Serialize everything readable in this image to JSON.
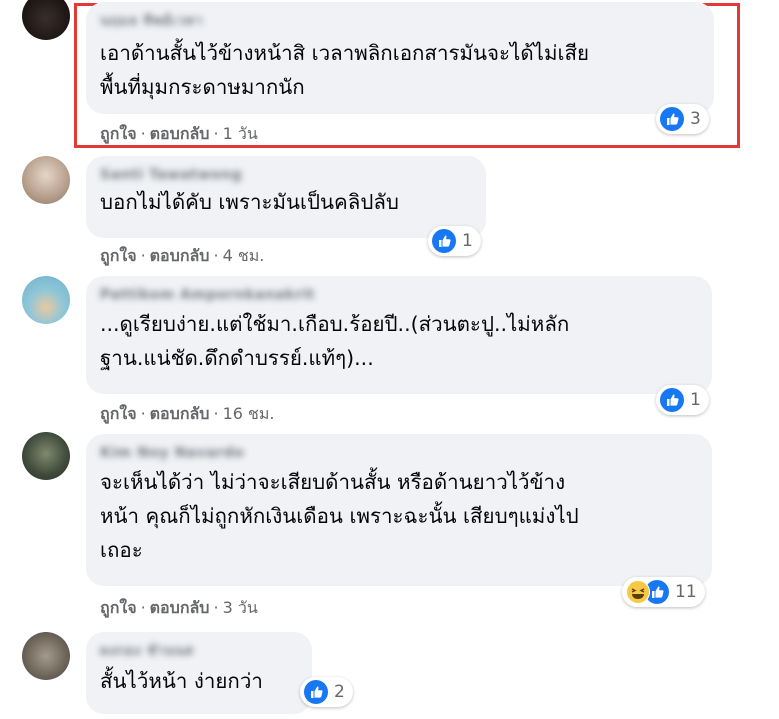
{
  "comments": [
    {
      "author": "นฤมล ทิพย์เวหา",
      "text": "เอาด้านสั้นไว้ข้างหน้าสิ เวลาพลิกเอกสารมันจะได้ไม่เสีย\nพื้นที่มุมกระดาษมากนัก",
      "like_label": "ถูกใจ",
      "reply_label": "ตอบกลับ",
      "time": "1 วัน",
      "reaction_count": "3"
    },
    {
      "author": "Santi Tawatwong",
      "text": "บอกไม่ได้คับ เพราะมันเป็นคลิปลับ",
      "like_label": "ถูกใจ",
      "reply_label": "ตอบกลับ",
      "time": "4 ชม.",
      "reaction_count": "1"
    },
    {
      "author": "Pattikom Ampornkanakrit",
      "text": "...ดูเรียบง่าย.แต่ใช้มา.เกือบ.ร้อยปี..(ส่วนตะปู..ไม่หลัก\nฐาน.แน่ชัด.ดึกดำบรรย์.แท้ๆ)...",
      "like_label": "ถูกใจ",
      "reply_label": "ตอบกลับ",
      "time": "16 ชม.",
      "reaction_count": "1"
    },
    {
      "author": "Kim Noy Navardo",
      "text": "จะเห็นได้ว่า ไม่ว่าจะเสียบด้านสั้น หรือด้านยาวไว้ข้าง\nหน้า คุณก็ไม่ถูกหักเงินเดือน เพราะฉะนั้น เสียบๆแม่งไป\nเถอะ",
      "like_label": "ถูกใจ",
      "reply_label": "ตอบกลับ",
      "time": "3 วัน",
      "reaction_count": "11"
    },
    {
      "author": "ผงกอง ชำนนส",
      "text": "สั้นไว้หน้า ง่ายกว่า",
      "reaction_count": "2"
    }
  ],
  "separator": "·",
  "colors": {
    "bubble": "#f0f2f5",
    "like_blue": "#1877f2",
    "highlight_red": "#e53935",
    "meta_gray": "#65676b"
  },
  "icons": {
    "like": "like-icon",
    "haha": "haha-icon"
  }
}
